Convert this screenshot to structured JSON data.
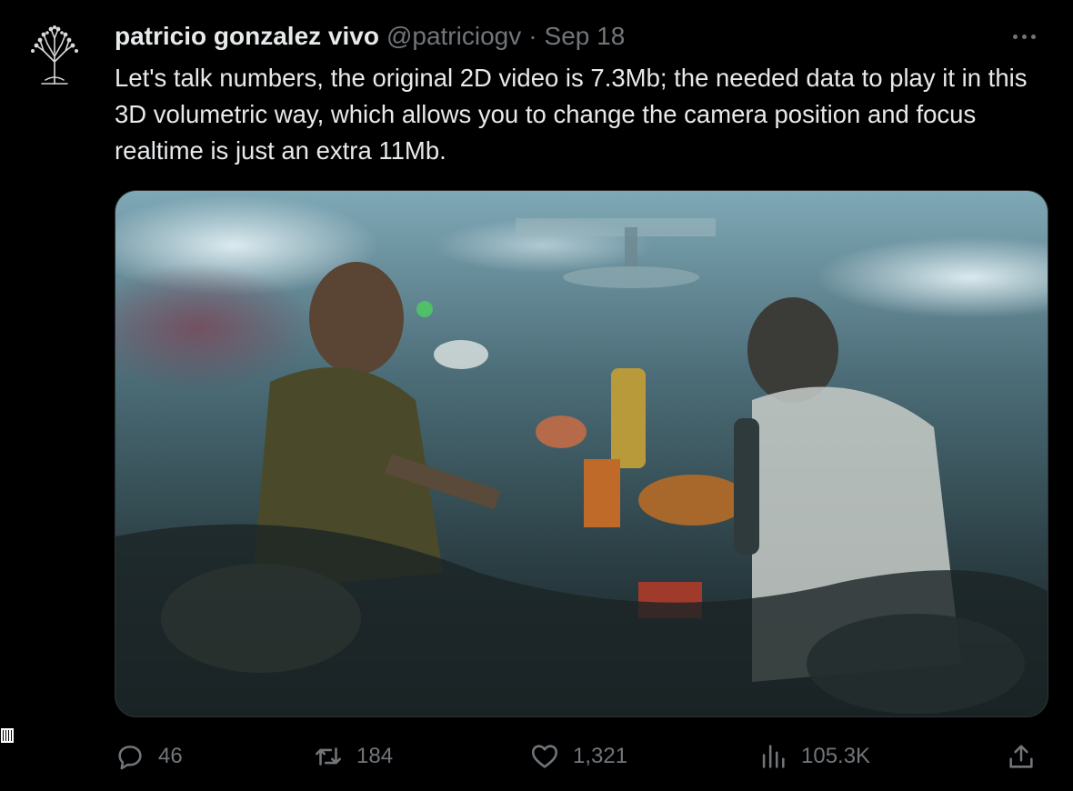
{
  "tweet": {
    "author_name": "patricio gonzalez vivo",
    "handle": "@patriciogv",
    "separator": "·",
    "date": "Sep 18",
    "text": "Let's talk numbers, the original 2D video is 7.3Mb; the needed data to play it in this 3D volumetric way, which allows you to change the camera position and focus realtime is just an extra 11Mb.",
    "avatar_icon": "tree-avatar-icon",
    "more_icon": "more-dots-icon",
    "media": {
      "type": "video-gif",
      "description_icon": "video-thumbnail"
    }
  },
  "actions": {
    "reply": {
      "icon": "reply-icon",
      "count": "46"
    },
    "retweet": {
      "icon": "retweet-icon",
      "count": "184"
    },
    "like": {
      "icon": "heart-icon",
      "count": "1,321"
    },
    "views": {
      "icon": "views-icon",
      "count": "105.3K"
    },
    "share": {
      "icon": "share-icon"
    }
  },
  "colors": {
    "background": "#000000",
    "text_primary": "#e7e9ea",
    "text_secondary": "#71767b",
    "border": "#2f3336"
  }
}
